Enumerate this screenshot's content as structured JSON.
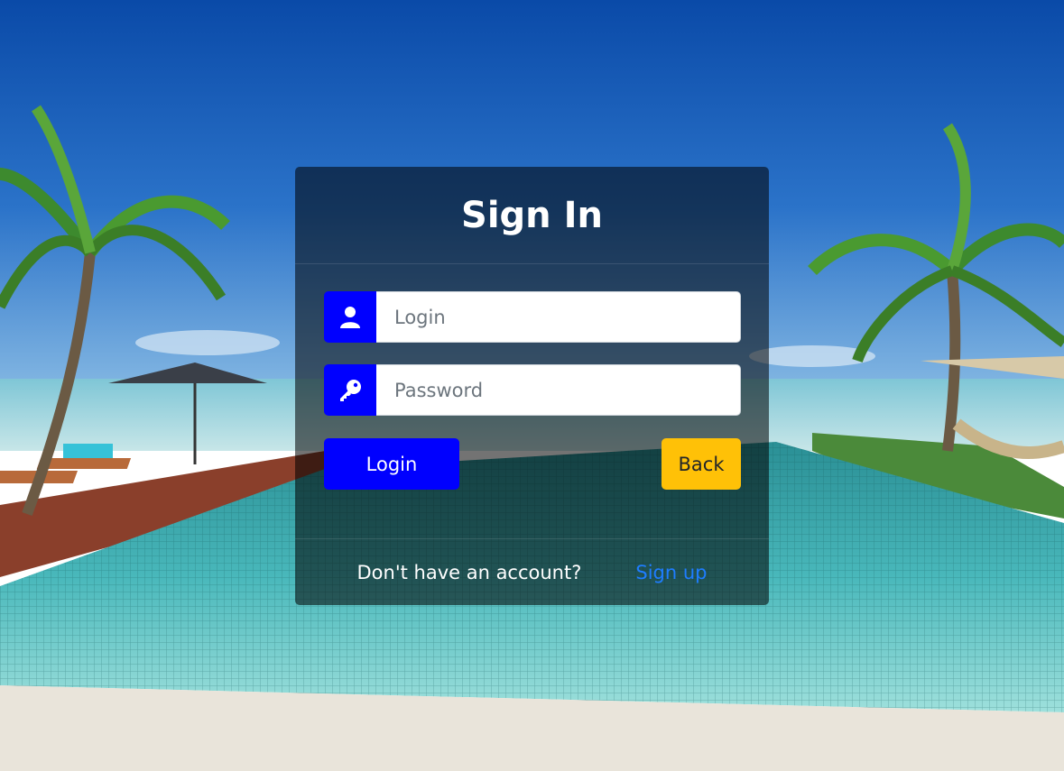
{
  "form": {
    "title": "Sign In",
    "login_placeholder": "Login",
    "password_placeholder": "Password",
    "login_button": "Login",
    "back_button": "Back",
    "footer_text": "Don't have an account?",
    "signup_link": "Sign up"
  },
  "icons": {
    "login_field": "user-icon",
    "password_field": "key-icon"
  },
  "colors": {
    "accent_blue": "#0000ff",
    "back_button": "#ffc107",
    "link": "#1e7dff"
  }
}
